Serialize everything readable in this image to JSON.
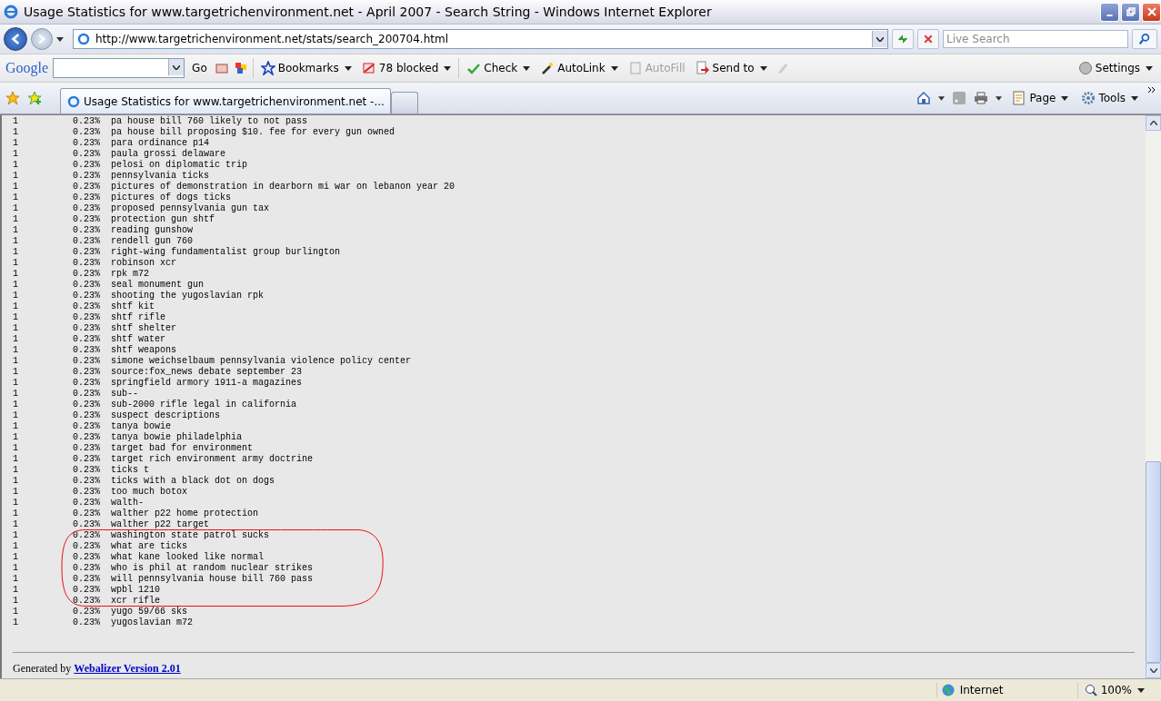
{
  "window": {
    "title": "Usage Statistics for www.targetrichenvironment.net - April 2007 - Search String - Windows Internet Explorer"
  },
  "address_bar": {
    "url": "http://www.targetrichenvironment.net/stats/search_200704.html"
  },
  "search": {
    "placeholder": "Live Search"
  },
  "google_toolbar": {
    "logo": "Google",
    "go": "Go",
    "items": [
      {
        "kind": "bookmarks",
        "label": "Bookmarks",
        "disabled": false
      },
      {
        "kind": "blocked",
        "label": "78 blocked",
        "disabled": false
      },
      {
        "kind": "check",
        "label": "Check",
        "disabled": false
      },
      {
        "kind": "autolink",
        "label": "AutoLink",
        "disabled": false
      },
      {
        "kind": "autofill",
        "label": "AutoFill",
        "disabled": true
      },
      {
        "kind": "sendto",
        "label": "Send to",
        "disabled": false
      }
    ],
    "settings": "Settings"
  },
  "tabs": [
    {
      "label": "Usage Statistics for www.targetrichenvironment.net -...",
      "selected": true
    }
  ],
  "command_bar": {
    "page": "Page",
    "tools": "Tools"
  },
  "rows": [
    {
      "count": "1",
      "percent": "0.23%",
      "query": "pa house bill 760 likely to not pass"
    },
    {
      "count": "1",
      "percent": "0.23%",
      "query": "pa house bill proposing $10. fee for every gun owned"
    },
    {
      "count": "1",
      "percent": "0.23%",
      "query": "para ordinance p14"
    },
    {
      "count": "1",
      "percent": "0.23%",
      "query": "paula grossi delaware"
    },
    {
      "count": "1",
      "percent": "0.23%",
      "query": "pelosi on diplomatic trip"
    },
    {
      "count": "1",
      "percent": "0.23%",
      "query": "pennsylvania ticks"
    },
    {
      "count": "1",
      "percent": "0.23%",
      "query": "pictures of demonstration in dearborn mi war on lebanon year 20"
    },
    {
      "count": "1",
      "percent": "0.23%",
      "query": "pictures of dogs ticks"
    },
    {
      "count": "1",
      "percent": "0.23%",
      "query": "proposed pennsylvania gun tax"
    },
    {
      "count": "1",
      "percent": "0.23%",
      "query": "protection gun shtf"
    },
    {
      "count": "1",
      "percent": "0.23%",
      "query": "reading gunshow"
    },
    {
      "count": "1",
      "percent": "0.23%",
      "query": "rendell gun 760"
    },
    {
      "count": "1",
      "percent": "0.23%",
      "query": "right-wing fundamentalist group burlington"
    },
    {
      "count": "1",
      "percent": "0.23%",
      "query": "robinson xcr"
    },
    {
      "count": "1",
      "percent": "0.23%",
      "query": "rpk m72"
    },
    {
      "count": "1",
      "percent": "0.23%",
      "query": "seal monument gun"
    },
    {
      "count": "1",
      "percent": "0.23%",
      "query": "shooting the yugoslavian rpk"
    },
    {
      "count": "1",
      "percent": "0.23%",
      "query": "shtf kit"
    },
    {
      "count": "1",
      "percent": "0.23%",
      "query": "shtf rifle"
    },
    {
      "count": "1",
      "percent": "0.23%",
      "query": "shtf shelter"
    },
    {
      "count": "1",
      "percent": "0.23%",
      "query": "shtf water"
    },
    {
      "count": "1",
      "percent": "0.23%",
      "query": "shtf weapons"
    },
    {
      "count": "1",
      "percent": "0.23%",
      "query": "simone weichselbaum pennsylvania violence policy center"
    },
    {
      "count": "1",
      "percent": "0.23%",
      "query": "source:fox_news debate september 23"
    },
    {
      "count": "1",
      "percent": "0.23%",
      "query": "springfield armory 1911-a magazines"
    },
    {
      "count": "1",
      "percent": "0.23%",
      "query": "sub--"
    },
    {
      "count": "1",
      "percent": "0.23%",
      "query": "sub-2000 rifle legal in california"
    },
    {
      "count": "1",
      "percent": "0.23%",
      "query": "suspect descriptions"
    },
    {
      "count": "1",
      "percent": "0.23%",
      "query": "tanya bowie"
    },
    {
      "count": "1",
      "percent": "0.23%",
      "query": "tanya bowie philadelphia"
    },
    {
      "count": "1",
      "percent": "0.23%",
      "query": "target bad for environment"
    },
    {
      "count": "1",
      "percent": "0.23%",
      "query": "target rich environment army doctrine"
    },
    {
      "count": "1",
      "percent": "0.23%",
      "query": "ticks t"
    },
    {
      "count": "1",
      "percent": "0.23%",
      "query": "ticks with a black dot on dogs"
    },
    {
      "count": "1",
      "percent": "0.23%",
      "query": "too much botox"
    },
    {
      "count": "1",
      "percent": "0.23%",
      "query": "walth-"
    },
    {
      "count": "1",
      "percent": "0.23%",
      "query": "walther p22 home protection"
    },
    {
      "count": "1",
      "percent": "0.23%",
      "query": "walther p22 target"
    },
    {
      "count": "1",
      "percent": "0.23%",
      "query": "washington state patrol sucks"
    },
    {
      "count": "1",
      "percent": "0.23%",
      "query": "what are ticks"
    },
    {
      "count": "1",
      "percent": "0.23%",
      "query": "what kane looked like normal"
    },
    {
      "count": "1",
      "percent": "0.23%",
      "query": "who is phil at random nuclear strikes"
    },
    {
      "count": "1",
      "percent": "0.23%",
      "query": "will pennsylvania house bill 760 pass"
    },
    {
      "count": "1",
      "percent": "0.23%",
      "query": "wpbl 1210"
    },
    {
      "count": "1",
      "percent": "0.23%",
      "query": "xcr rifle"
    },
    {
      "count": "1",
      "percent": "0.23%",
      "query": "yugo 59/66 sks"
    },
    {
      "count": "1",
      "percent": "0.23%",
      "query": "yugoslavian m72"
    }
  ],
  "footer": {
    "prefix": "Generated by",
    "link": "Webalizer Version 2.01"
  },
  "status_bar": {
    "zone": "Internet",
    "zoom": "100%"
  }
}
